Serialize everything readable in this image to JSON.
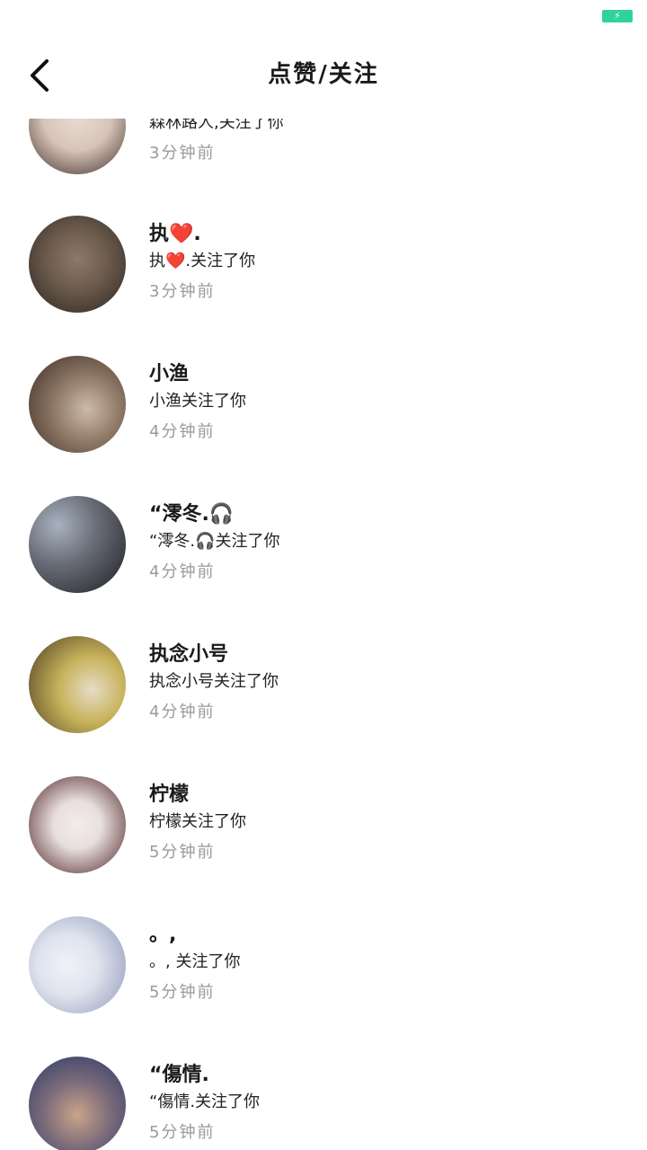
{
  "status_bar": {
    "battery_icon": "charging-battery-icon",
    "battery_color": "#2fd39a"
  },
  "header": {
    "title": "点赞/关注",
    "back_icon": "chevron-left-icon"
  },
  "items": [
    {
      "name": "",
      "desc": "森林路人,关注了你",
      "time": "3分钟前",
      "avatar_colors": [
        "#e9dcd4",
        "#3c2f2a"
      ]
    },
    {
      "name": "执❤️.",
      "desc": "执❤️.关注了你",
      "time": "3分钟前",
      "avatar_colors": [
        "#8b7a6a",
        "#2b2420"
      ]
    },
    {
      "name": "小渔",
      "desc": "小渔关注了你",
      "time": "4分钟前",
      "avatar_colors": [
        "#cdbba8",
        "#3a2c24"
      ]
    },
    {
      "name": "“澪冬.🎧",
      "desc": "“澪冬.🎧关注了你",
      "time": "4分钟前",
      "avatar_colors": [
        "#a9b2c0",
        "#1e1e24"
      ]
    },
    {
      "name": "执念小号",
      "desc": "执念小号关注了你",
      "time": "4分钟前",
      "avatar_colors": [
        "#c7b35a",
        "#4a3a22"
      ]
    },
    {
      "name": "柠檬",
      "desc": "柠檬关注了你",
      "time": "5分钟前",
      "avatar_colors": [
        "#e8dede",
        "#5a4040"
      ]
    },
    {
      "name": "。,",
      "desc": "。, 关注了你",
      "time": "5分钟前",
      "avatar_colors": [
        "#dfe3ee",
        "#8f99b8"
      ]
    },
    {
      "name": "“傷情.",
      "desc": "“傷情.关注了你",
      "time": "5分钟前",
      "avatar_colors": [
        "#2a3a66",
        "#c9a48a"
      ]
    }
  ]
}
